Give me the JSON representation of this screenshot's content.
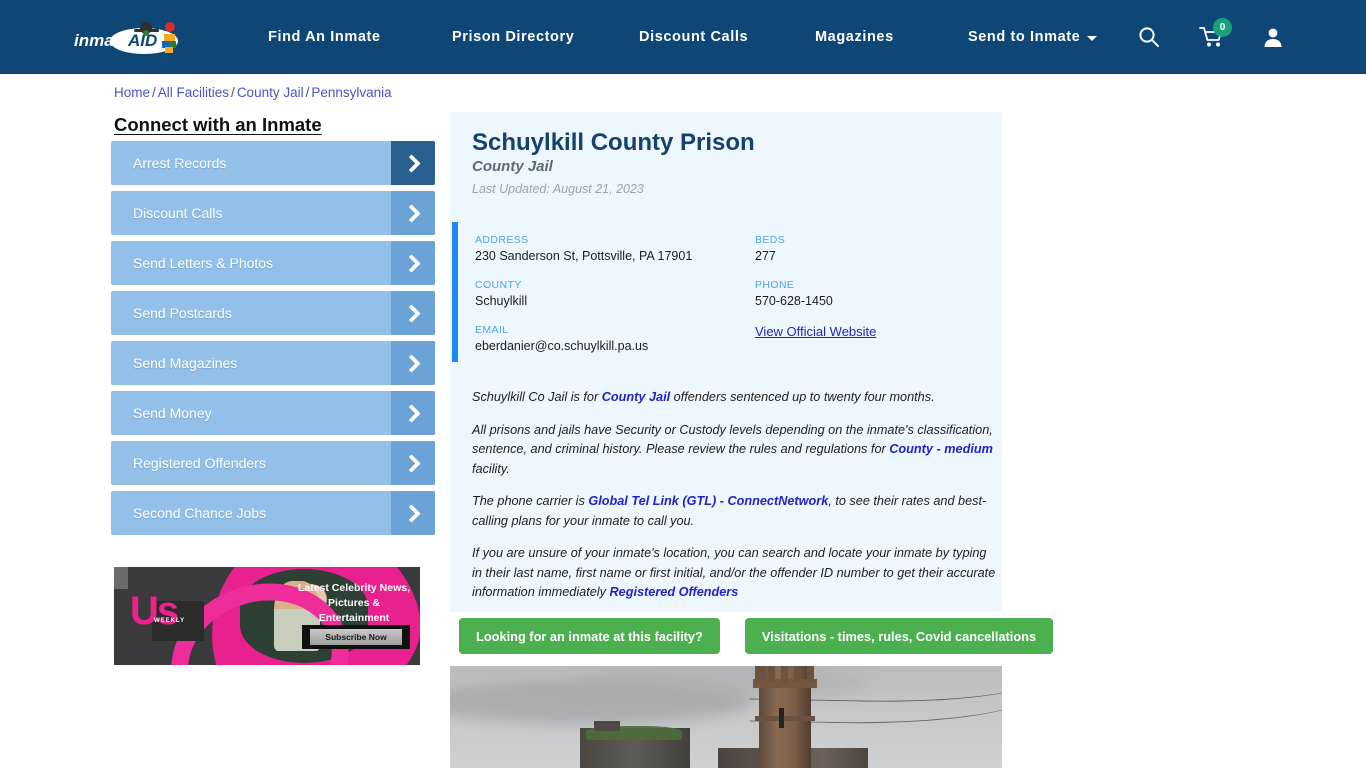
{
  "header": {
    "logo_text": "inmateAID",
    "nav": [
      {
        "label": "Find An Inmate",
        "has_caret": false
      },
      {
        "label": "Prison Directory",
        "has_caret": false
      },
      {
        "label": "Discount Calls",
        "has_caret": false
      },
      {
        "label": "Magazines",
        "has_caret": false
      },
      {
        "label": "Send to Inmate",
        "has_caret": true
      }
    ],
    "search_icon": "search-icon",
    "cart_icon": "cart-icon",
    "cart_count": "0",
    "account_icon": "user-icon",
    "bg_color": "#0e4675",
    "badge_color": "#1aa179"
  },
  "breadcrumb": {
    "items": [
      "Home",
      "All Facilities",
      "County Jail",
      "Pennsylvania"
    ],
    "separator": "/"
  },
  "sidebar": {
    "title": "Connect with an Inmate",
    "items": [
      {
        "label": "Arrest Records",
        "active": true
      },
      {
        "label": "Discount Calls",
        "active": false
      },
      {
        "label": "Send Letters & Photos",
        "active": false
      },
      {
        "label": "Send Postcards",
        "active": false
      },
      {
        "label": "Send Magazines",
        "active": false
      },
      {
        "label": "Send Money",
        "active": false
      },
      {
        "label": "Registered Offenders",
        "active": false
      },
      {
        "label": "Second Chance Jobs",
        "active": false
      }
    ],
    "item_color": "#93c0e8",
    "arrow_color": "#6ba3d6",
    "arrow_active_color": "#2a5f90"
  },
  "ad": {
    "brand": "Us",
    "brand_sub": "WEEKLY",
    "headline": "Latest Celebrity News, Pictures & Entertainment",
    "cta": "Subscribe Now"
  },
  "facility": {
    "name": "Schuylkill County Prison",
    "type": "County Jail",
    "last_updated": "Last Updated: August 21, 2023",
    "fields": {
      "address_label": "ADDRESS",
      "address_value": "230 Sanderson St, Pottsville, PA 17901",
      "county_label": "COUNTY",
      "county_value": "Schuylkill",
      "email_label": "EMAIL",
      "email_value": "eberdanier@co.schuylkill.pa.us",
      "beds_label": "BEDS",
      "beds_value": "277",
      "phone_label": "PHONE",
      "phone_value": "570-628-1450",
      "website_link": "View Official Website"
    },
    "accent_color": "#1a8cf0",
    "card_bg": "#eef7fd"
  },
  "description": {
    "p1_a": "Schuylkill Co Jail is for ",
    "p1_link": "County Jail",
    "p1_b": " offenders sentenced up to twenty four months.",
    "p2_a": "All prisons and jails have Security or Custody levels depending on the inmate's classification, sentence, and criminal history. Please review the rules and regulations for ",
    "p2_link": "County - medium",
    "p2_b": " facility.",
    "p3_a": "The phone carrier is ",
    "p3_link": "Global Tel Link (GTL) - ConnectNetwork",
    "p3_b": ", to see their rates and best-calling plans for your inmate to call you.",
    "p4_a": "If you are unsure of your inmate's location, you can search and locate your inmate by typing in their last name, first name or first initial, and/or the offender ID number to get their accurate information immediately ",
    "p4_link": "Registered Offenders"
  },
  "actions": {
    "find_inmate": "Looking for an inmate at this facility?",
    "visitations": "Visitations - times, rules, Covid cancellations",
    "button_color": "#4caf50"
  },
  "photo": {
    "alt": "Schuylkill County Prison stone building with castle tower under overcast sky"
  }
}
